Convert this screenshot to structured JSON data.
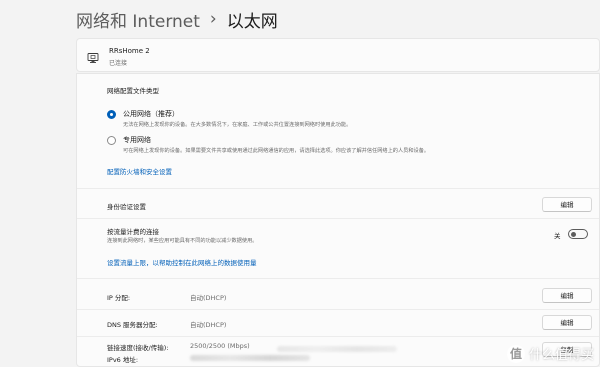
{
  "breadcrumb": {
    "parent": "网络和 Internet",
    "separator": "›",
    "current": "以太网"
  },
  "network": {
    "name": "RRsHome 2",
    "status": "已连接",
    "icon": "ethernet-computer-icon"
  },
  "profile": {
    "title": "网络配置文件类型",
    "options": [
      {
        "label": "公用网络（推荐）",
        "desc": "无法在网络上发现你的设备。在大多数情况下，在家庭、工作或公共位置连接到网络时使用此功能。",
        "selected": true
      },
      {
        "label": "专用网络",
        "desc": "可在网络上发现你的设备。如果需要文件共享或使用通过此网络通信的应用，请选择此选项。你应该了解并信任网络上的人员和设备。",
        "selected": false
      }
    ],
    "firewall_link": "配置防火墙和安全设置"
  },
  "auth": {
    "label": "身份验证设置",
    "button": "编辑"
  },
  "metered": {
    "label": "按流量计费的连接",
    "desc": "连接到此网络时，某些应用可能具有不同的功能以减少数据使用。",
    "toggle_state": "关",
    "toggle_on": false,
    "link": "设置流量上限，以帮助控制在此网络上的数据使用量"
  },
  "ip": {
    "label": "IP 分配:",
    "value": "自动(DHCP)",
    "button": "编辑"
  },
  "dns": {
    "label": "DNS 服务器分配:",
    "value": "自动(DHCP)",
    "button": "编辑"
  },
  "props": {
    "speed_label": "链接速度(接收/传输):",
    "speed_value": "2500/2500 (Mbps)",
    "ipv6_label": "IPv6 地址:",
    "copy_button": "复制"
  },
  "watermark": {
    "logo_glyph": "值",
    "text": "什么值得买"
  },
  "colors": {
    "accent": "#005fb8",
    "background": "#f3f3f3",
    "card": "#fbfbfb"
  }
}
